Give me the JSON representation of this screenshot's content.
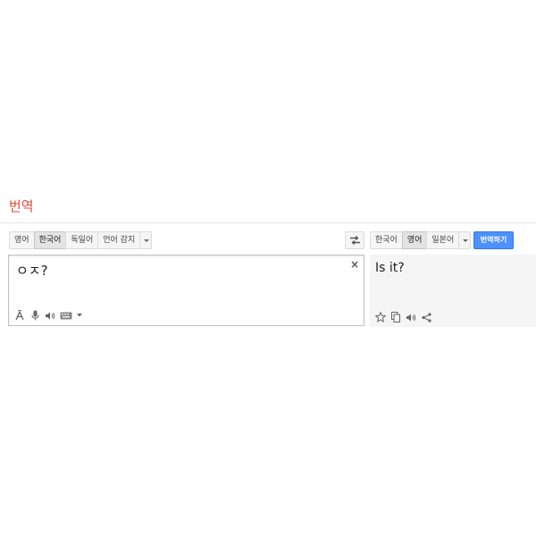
{
  "page": {
    "title": "번역"
  },
  "source_langs": {
    "items": [
      {
        "label": "영어",
        "active": false
      },
      {
        "label": "한국어",
        "active": true
      },
      {
        "label": "독일어",
        "active": false
      },
      {
        "label": "언어 감지",
        "active": false
      }
    ]
  },
  "target_langs": {
    "items": [
      {
        "label": "한국어",
        "active": false
      },
      {
        "label": "영어",
        "active": true
      },
      {
        "label": "일본어",
        "active": false
      }
    ]
  },
  "translate_button": {
    "label": "번역하기",
    "color": "#4d90fe"
  },
  "source": {
    "text": "ㅇㅈ?",
    "clear_symbol": "×"
  },
  "result": {
    "text": "Is it?"
  },
  "source_tools": [
    "font-accent-icon",
    "microphone-icon",
    "speaker-icon",
    "keyboard-icon",
    "chevron-down-icon"
  ],
  "result_tools": [
    "star-icon",
    "copy-icon",
    "speaker-icon",
    "share-icon"
  ],
  "colors": {
    "title": "#dd4b39",
    "accent": "#4d90fe"
  }
}
